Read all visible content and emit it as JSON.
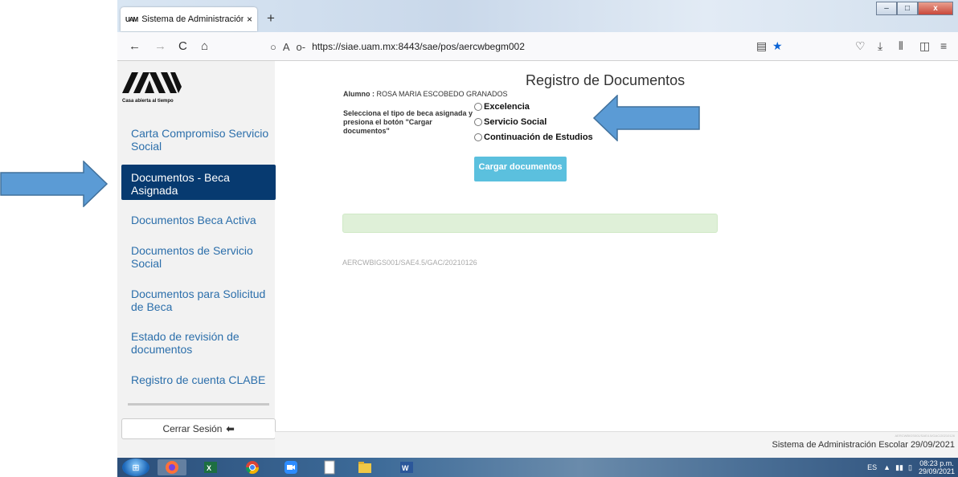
{
  "browser": {
    "tab_title": "Sistema de Administración Esco",
    "tab_favicon": "UAM",
    "tab_close": "×",
    "new_tab": "+",
    "url": "https://siae.uam.mx:8443/sae/pos/aercwbegm002",
    "window_controls": {
      "minimize": "–",
      "maximize": "□",
      "close": "x"
    }
  },
  "icons": {
    "back": "←",
    "forward": "→",
    "reload": "C",
    "home": "⌂",
    "shield": "○",
    "lock": "A",
    "key": "o‐",
    "reader": "▤",
    "bookmark_star": "★",
    "pocket": "♡",
    "download": "⤓",
    "library": "⫴",
    "sidebar": "◫",
    "menu": "≡",
    "logout": "⬅"
  },
  "sidebar": {
    "logo_tagline": "Casa abierta al tiempo",
    "items": [
      {
        "label": "Carta Compromiso Servicio Social"
      },
      {
        "label": "Documentos - Beca Asignada"
      },
      {
        "label": "Documentos Beca Activa"
      },
      {
        "label": "Documentos de Servicio Social"
      },
      {
        "label": "Documentos para Solicitud de Beca"
      },
      {
        "label": "Estado de revisión de documentos"
      },
      {
        "label": "Registro de cuenta CLABE"
      }
    ],
    "logout_label": "Cerrar Sesión"
  },
  "main": {
    "title": "Registro de Documentos",
    "student_label": "Alumno :",
    "student_name": "ROSA MARIA ESCOBEDO GRANADOS",
    "instruction": "Selecciona el tipo de beca asignada y presiona el botón \"Cargar documentos\"",
    "options": [
      {
        "label": "Excelencia"
      },
      {
        "label": "Servicio Social"
      },
      {
        "label": "Continuación de Estudios"
      }
    ],
    "upload_button": "Cargar documentos",
    "version": "AERCWBIGS001/SAE4.5/GAC/20210126"
  },
  "footer": {
    "mini_code": "AERCWBIGS001/SAE4.5/GAC/20210126",
    "text": "Sistema de Administración Escolar 29/09/2021"
  },
  "taskbar": {
    "lang": "ES",
    "time": "08:23 p.m.",
    "date": "29/09/2021"
  },
  "colors": {
    "active_nav": "#073a70",
    "nav_link": "#2c6fab",
    "upload_button": "#5bc0de",
    "arrow": "#5b9bd5",
    "alert_bg": "#dff0d8"
  }
}
